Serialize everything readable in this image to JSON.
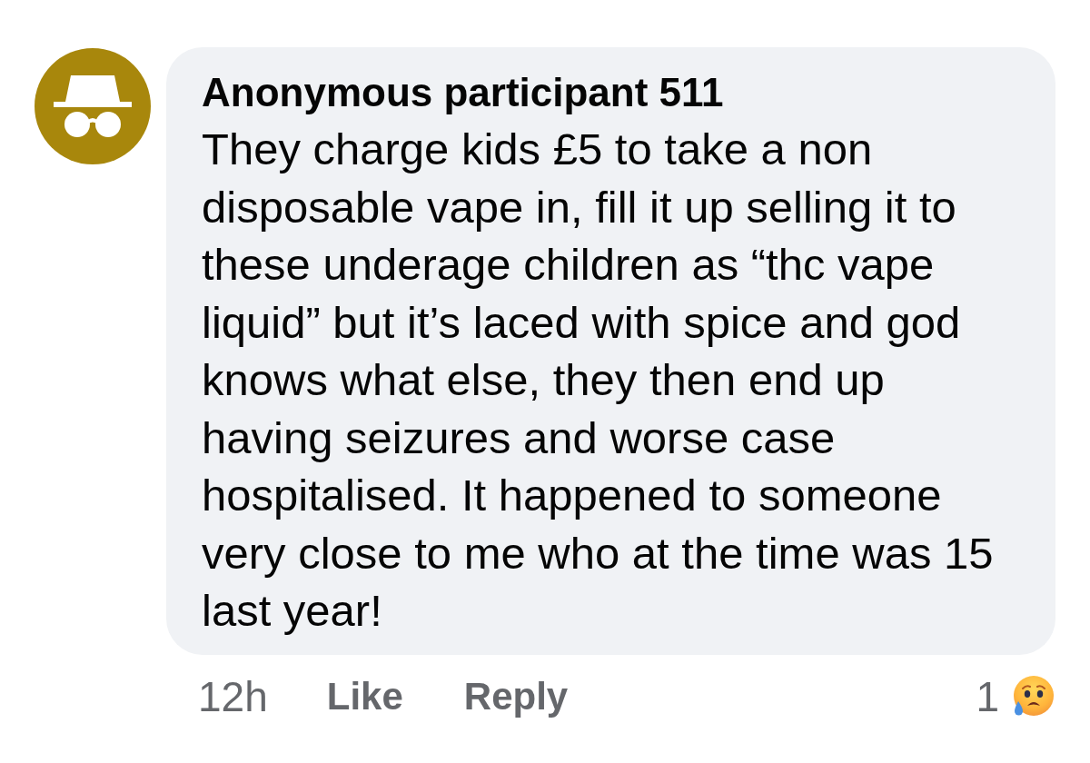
{
  "comment": {
    "author": "Anonymous participant 511",
    "text": "They charge kids £5 to take a non disposable vape in, fill it up selling it to these underage children as “thc vape liquid” but it’s laced with spice and god knows what else, they then end up having seizures and worse case hospitalised. It happened to someone very close to me who at the time was 15 last year!"
  },
  "footer": {
    "time": "12h",
    "actions": [
      "Like",
      "Reply"
    ],
    "reaction_count": "1"
  }
}
